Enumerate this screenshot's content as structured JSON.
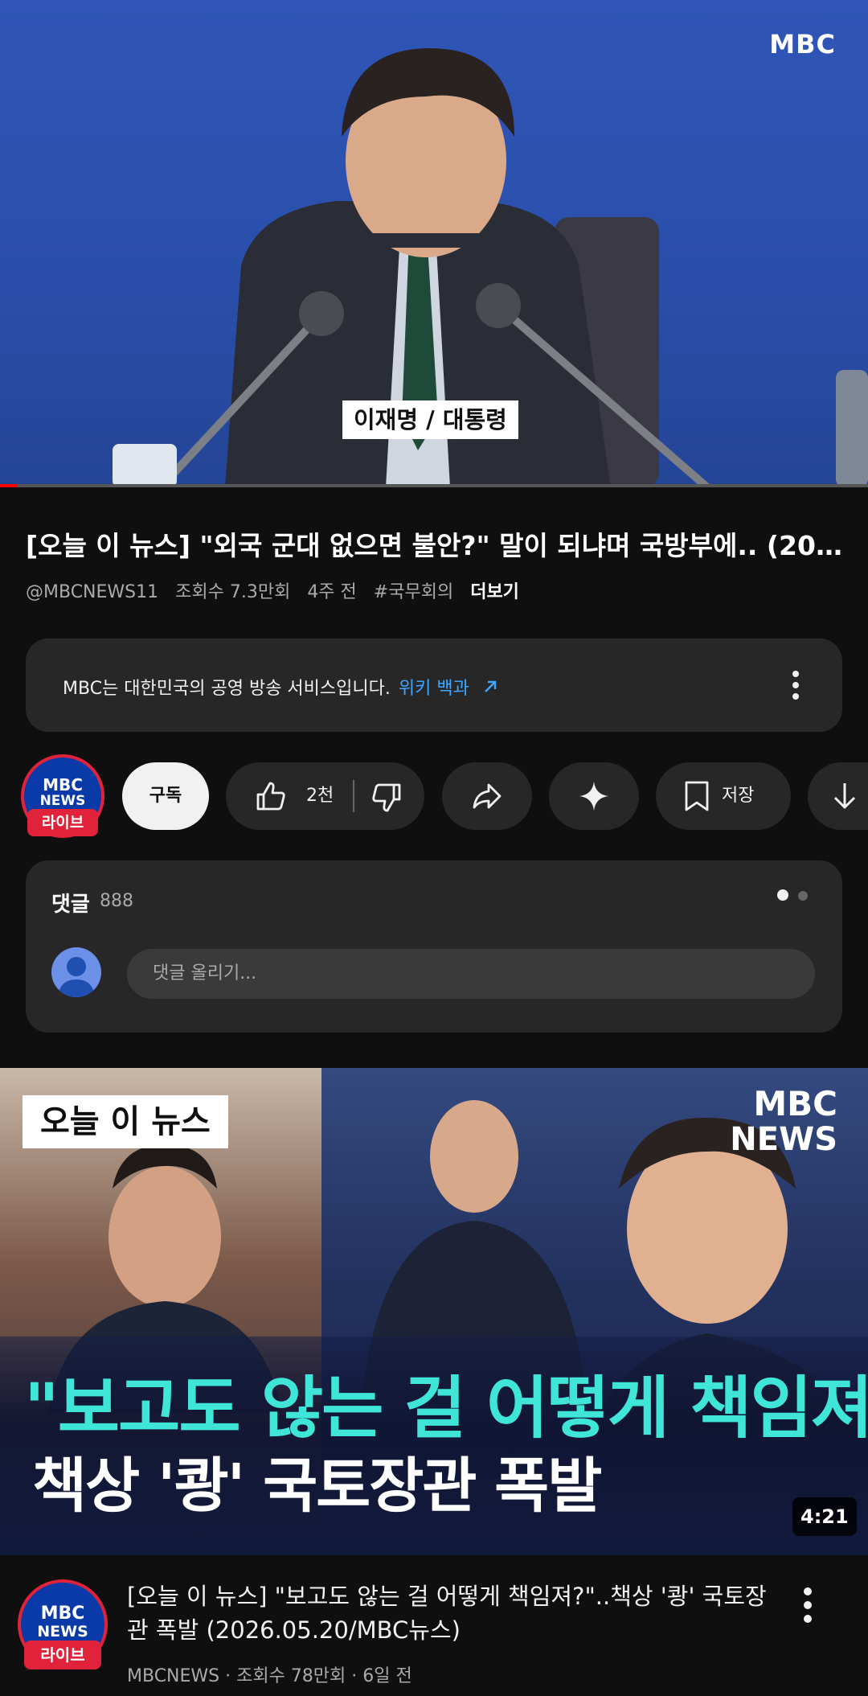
{
  "player": {
    "watermark": "MBC",
    "caption": "이재명 / 대통령"
  },
  "video": {
    "title": "[오늘 이 뉴스] \"외국 군대 없으면 불안?\" 말이 되냐며 국방부에.. (20...",
    "channel_handle": "@MBCNEWS11",
    "views": "조회수 7.3만회",
    "age": "4주 전",
    "hashtag": "#국무회의",
    "more_label": "더보기"
  },
  "info_card": {
    "text": "MBC는 대한민국의 공영 방송 서비스입니다.",
    "link": "위키 백과"
  },
  "channel": {
    "logo_line1": "MBC",
    "logo_line2": "NEWS",
    "live_badge": "라이브"
  },
  "actions": {
    "subscribe": "구독",
    "like_count": "2천",
    "save": "저장"
  },
  "comments": {
    "label": "댓글",
    "count": "888",
    "placeholder": "댓글 올리기..."
  },
  "recommended": {
    "thumb_tag": "오늘 이 뉴스",
    "thumb_brand_line1": "MBC",
    "thumb_brand_line2": "NEWS",
    "thumb_headline1": "\"보고도 않는 걸 어떻게 책임져?\"",
    "thumb_headline2": "책상 '쾅' 국토장관 폭발",
    "duration": "4:21",
    "title": "[오늘 이 뉴스] \"보고도 않는 걸 어떻게 책임져?\"..책상 '쾅' 국토장관 폭발 (2026.05.20/MBC뉴스)",
    "meta": "MBCNEWS · 조회수 78만회 · 6일 전"
  },
  "colors": {
    "background": "#0f0f0f",
    "card": "#272727",
    "link": "#3ea6ff",
    "live": "#e0223a",
    "headline_accent": "#3fe6d8"
  }
}
